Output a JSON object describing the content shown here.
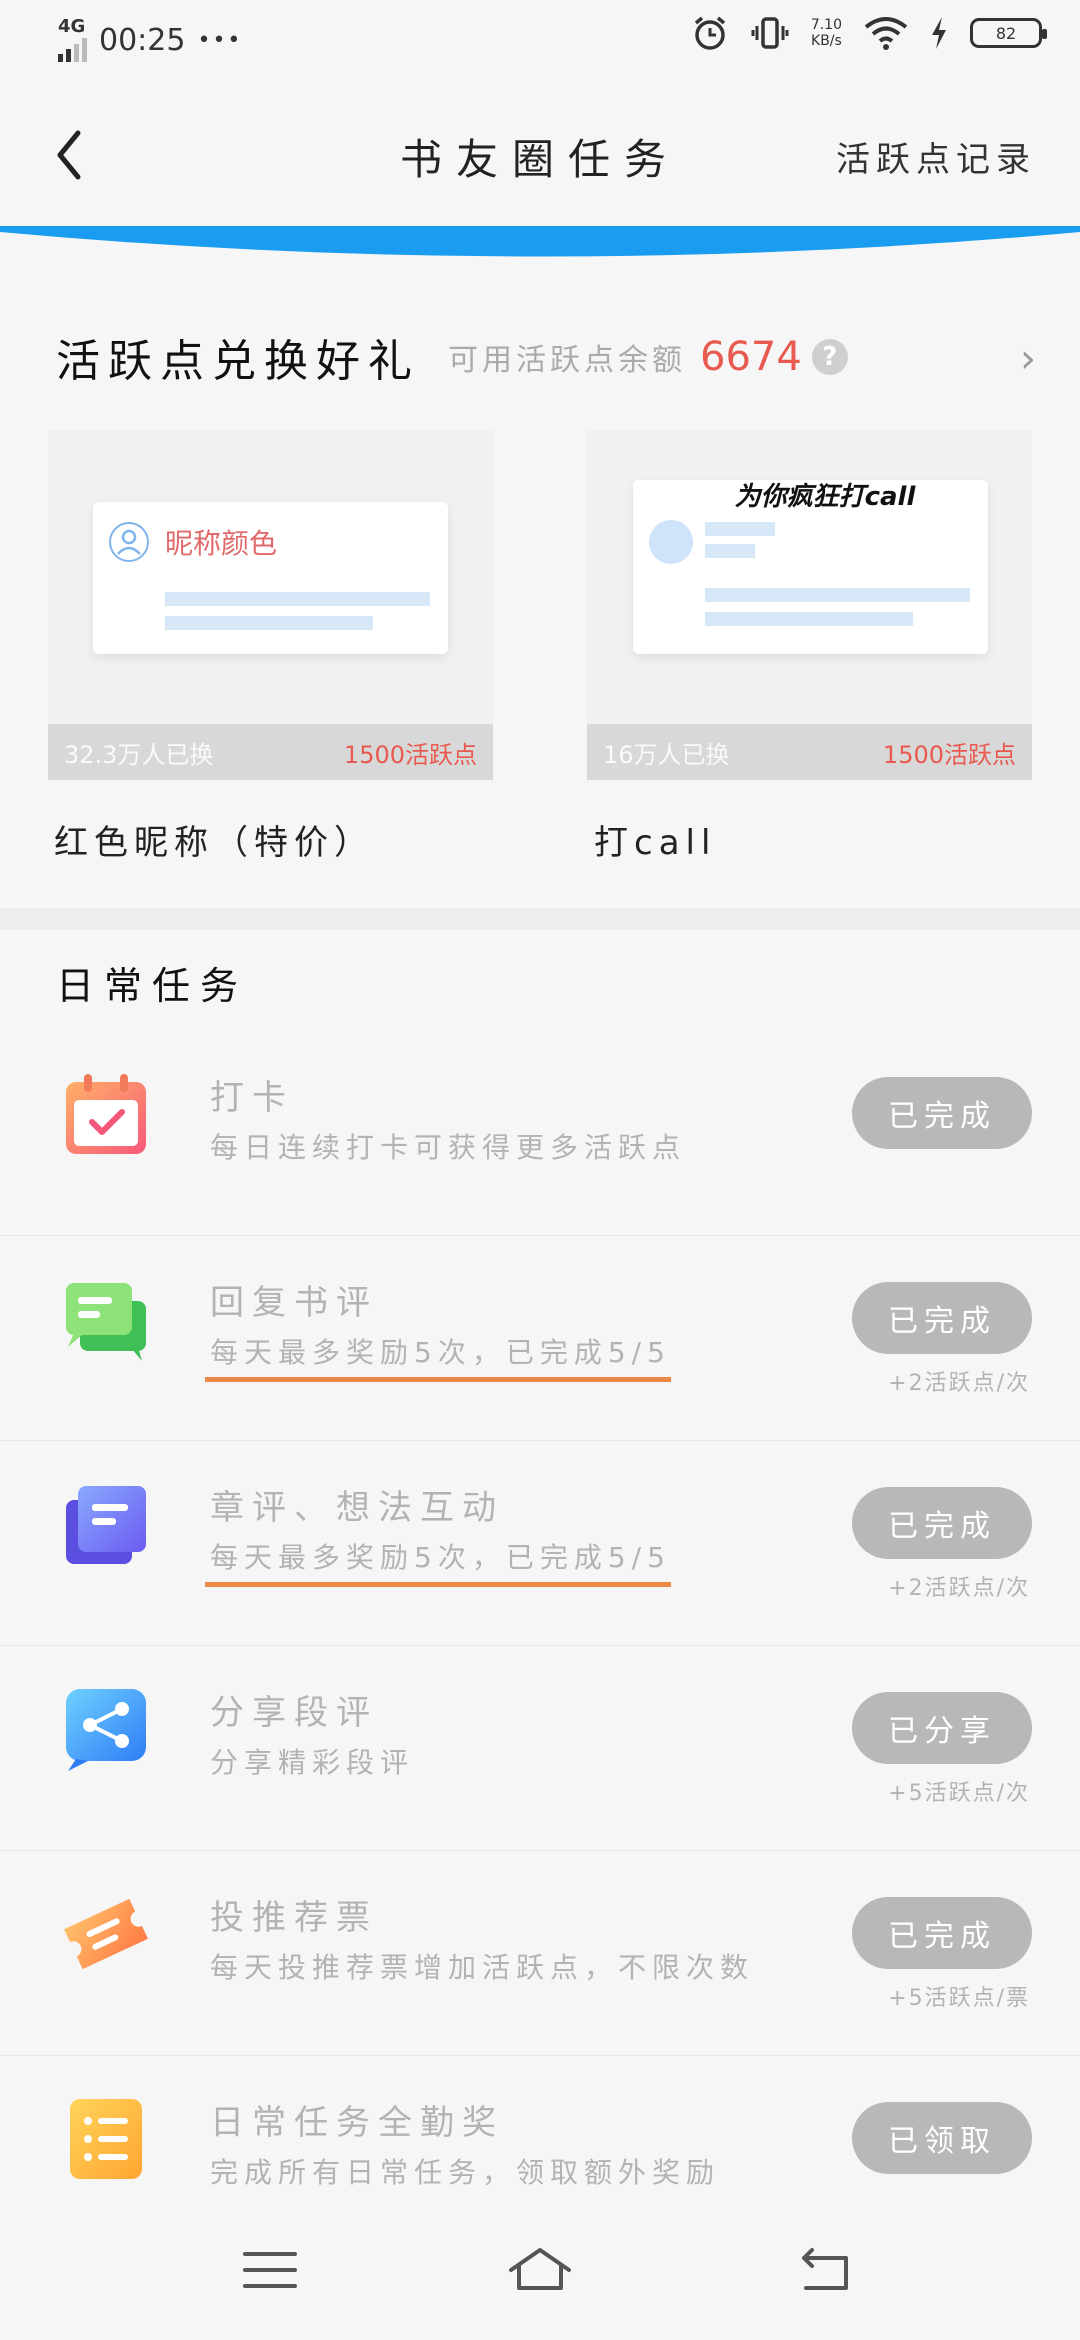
{
  "status": {
    "network": "4G",
    "time": "00:25",
    "dots": "•••",
    "speed_value": "7.10",
    "speed_unit": "KB/s",
    "battery": "82"
  },
  "header": {
    "title": "书友圈任务",
    "record_link": "活跃点记录"
  },
  "exchange": {
    "title": "活跃点兑换好礼",
    "balance_label": "可用活跃点余额",
    "balance": "6674",
    "help": "?",
    "arrow": "›",
    "gifts": [
      {
        "name": "红色昵称（特价）",
        "count": "32.3万人已换",
        "price": "1500活跃点",
        "preview_text": "昵称颜色"
      },
      {
        "name": "打call",
        "count": "16万人已换",
        "price": "1500活跃点",
        "preview_text": "为你疯狂打call"
      }
    ]
  },
  "daily": {
    "title": "日常任务",
    "tasks": [
      {
        "name": "打卡",
        "desc": "每日连续打卡可获得更多活跃点",
        "button": "已完成",
        "reward": "",
        "icon": "calendar-icon"
      },
      {
        "name": "回复书评",
        "desc": "每天最多奖励5次，已完成5/5",
        "button": "已完成",
        "reward": "+2活跃点/次",
        "icon": "chat-bubbles-icon"
      },
      {
        "name": "章评、想法互动",
        "desc": "每天最多奖励5次，已完成5/5",
        "button": "已完成",
        "reward": "+2活跃点/次",
        "icon": "notes-icon"
      },
      {
        "name": "分享段评",
        "desc": "分享精彩段评",
        "button": "已分享",
        "reward": "+5活跃点/次",
        "icon": "share-icon"
      },
      {
        "name": "投推荐票",
        "desc": "每天投推荐票增加活跃点，不限次数",
        "button": "已完成",
        "reward": "+5活跃点/票",
        "icon": "ticket-icon"
      },
      {
        "name": "日常任务全勤奖",
        "desc": "完成所有日常任务，领取额外奖励",
        "button": "已领取",
        "reward": "",
        "icon": "list-icon"
      }
    ]
  },
  "colors": {
    "accent_blue": "#1a9cf0",
    "balance_red": "#e85a4f",
    "underline_orange": "#ec8a45",
    "button_gray": "#b8b8b8"
  }
}
